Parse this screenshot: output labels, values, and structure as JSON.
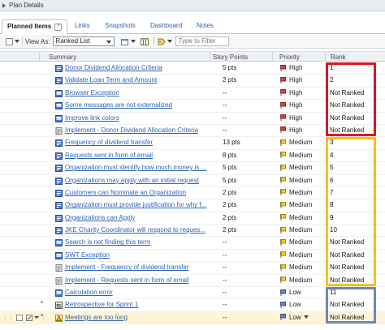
{
  "panel": {
    "title": "Plan Details"
  },
  "tabs": [
    {
      "label": "Planned Items",
      "active": true
    },
    {
      "label": "Links",
      "active": false
    },
    {
      "label": "Snapshots",
      "active": false
    },
    {
      "label": "Dashboard",
      "active": false
    },
    {
      "label": "Notes",
      "active": false
    }
  ],
  "toolbar": {
    "view_as_label": "View As:",
    "view_value": "Ranked List",
    "filter_placeholder": "Type to Filter"
  },
  "columns": {
    "summary": "Summary",
    "story_points": "Story Points",
    "priority": "Priority",
    "rank": "Rank"
  },
  "rows": [
    {
      "summary": "Donor Dividend Allocation Criteria",
      "points": "5 pts",
      "priority": "High",
      "rank": "1",
      "type": "story"
    },
    {
      "summary": "Validate Loan Term and Amount",
      "points": "2 pts",
      "priority": "High",
      "rank": "2",
      "type": "story"
    },
    {
      "summary": "Browser Exception",
      "points": "--",
      "priority": "High",
      "rank": "Not Ranked",
      "type": "defect"
    },
    {
      "summary": "Some messages are not externalized",
      "points": "--",
      "priority": "High",
      "rank": "Not Ranked",
      "type": "defect"
    },
    {
      "summary": "Improve link colors",
      "points": "--",
      "priority": "High",
      "rank": "Not Ranked",
      "type": "defect"
    },
    {
      "summary": "Implement - Donor Dividend Allocation Criteria",
      "points": "--",
      "priority": "High",
      "rank": "Not Ranked",
      "type": "task"
    },
    {
      "summary": "Frequency of dividend transfer",
      "points": "13 pts",
      "priority": "Medium",
      "rank": "3",
      "type": "story"
    },
    {
      "summary": "Requests sent in form of email",
      "points": "8 pts",
      "priority": "Medium",
      "rank": "4",
      "type": "story"
    },
    {
      "summary": "Organization must identify how much money is ...",
      "points": "5 pts",
      "priority": "Medium",
      "rank": "5",
      "type": "story"
    },
    {
      "summary": "Organizations may apply with an initial request",
      "points": "5 pts",
      "priority": "Medium",
      "rank": "6",
      "type": "story"
    },
    {
      "summary": "Customers can Nominate an Organization",
      "points": "2 pts",
      "priority": "Medium",
      "rank": "7",
      "type": "story"
    },
    {
      "summary": "Organization must provide justification for why f...",
      "points": "2 pts",
      "priority": "Medium",
      "rank": "8",
      "type": "story"
    },
    {
      "summary": "Organizations can Apply",
      "points": "2 pts",
      "priority": "Medium",
      "rank": "9",
      "type": "story"
    },
    {
      "summary": "JKE Charity Coordinator will respond to reques...",
      "points": "2 pts",
      "priority": "Medium",
      "rank": "10",
      "type": "story"
    },
    {
      "summary": "Search is not finding this term",
      "points": "--",
      "priority": "Medium",
      "rank": "Not Ranked",
      "type": "defect"
    },
    {
      "summary": "SWT Exception",
      "points": "--",
      "priority": "Medium",
      "rank": "Not Ranked",
      "type": "defect"
    },
    {
      "summary": "Implement - Frequency of dividend transfer",
      "points": "--",
      "priority": "Medium",
      "rank": "Not Ranked",
      "type": "task"
    },
    {
      "summary": "Implement - Requests sent in form of email",
      "points": "--",
      "priority": "Medium",
      "rank": "Not Ranked",
      "type": "task"
    },
    {
      "summary": "Calculation error",
      "points": "--",
      "priority": "Low",
      "rank": "11",
      "type": "defect"
    },
    {
      "summary": "Retrospective for Sprint 1",
      "points": "--",
      "priority": "Low",
      "rank": "Not Ranked",
      "type": "retro",
      "marker": "*"
    },
    {
      "summary": "Meetings are too long",
      "points": "--",
      "priority": "Low",
      "rank": "Not Ranked",
      "type": "impediment",
      "marker": "*",
      "selected": true,
      "dropdown": true
    }
  ],
  "colors": {
    "high_group": "#e0141e",
    "medium_group": "#f2c21a",
    "low_group": "#6b88b8",
    "link": "#2a64b4"
  }
}
